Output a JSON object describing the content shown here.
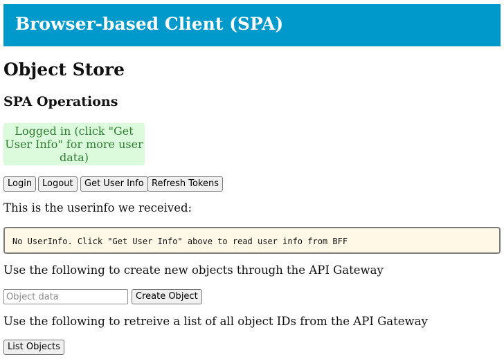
{
  "header": {
    "title": "Browser-based Client (SPA)"
  },
  "page_title": "Object Store",
  "section_title": "SPA Operations",
  "status": {
    "line1": "Logged in (click \"Get",
    "line2": "User Info\" for more user",
    "line3": "data)"
  },
  "buttons": {
    "login": "Login",
    "logout": "Logout",
    "get_user_info": "Get User Info",
    "refresh_tokens": "Refresh Tokens",
    "create_object": "Create Object",
    "list_objects": "List Objects"
  },
  "userinfo": {
    "intro": "This is the userinfo we received:",
    "content": "No UserInfo. Click \"Get User Info\" above to read user info from BFF"
  },
  "create": {
    "intro": "Use the following to create new objects through the API Gateway",
    "placeholder": "Object data",
    "value": ""
  },
  "list": {
    "intro": "Use the following to retreive a list of all object IDs from the API Gateway"
  }
}
